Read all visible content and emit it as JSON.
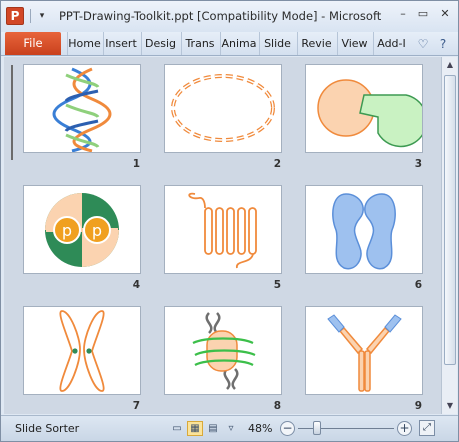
{
  "titlebar": {
    "app_icon_letter": "P",
    "title": "PPT-Drawing-Toolkit.ppt [Compatibility Mode] - Microsoft Po...",
    "quick_access_dropdown": "▾",
    "minimize": "–",
    "restore": "▭",
    "close": "✕"
  },
  "ribbon": {
    "file_label": "File",
    "tabs": [
      "Home",
      "Insert",
      "Design",
      "Transitions",
      "Animations",
      "Slide Show",
      "Review",
      "View",
      "Add-Ins"
    ],
    "tab_display": [
      "Home",
      "Insert",
      "Desig",
      "Trans",
      "Anima",
      "Slide",
      "Revie",
      "View",
      "Add-I"
    ],
    "icons": [
      "heart-icon",
      "help-icon"
    ]
  },
  "slides": [
    {
      "number": "1",
      "content": "dna-double-helix"
    },
    {
      "number": "2",
      "content": "dashed-ellipse"
    },
    {
      "number": "3",
      "content": "enzyme-substrate"
    },
    {
      "number": "4",
      "content": "phosphate-circle"
    },
    {
      "number": "5",
      "content": "membrane-protein"
    },
    {
      "number": "6",
      "content": "blue-kidney-shapes"
    },
    {
      "number": "7",
      "content": "chromosome"
    },
    {
      "number": "8",
      "content": "nucleosome"
    },
    {
      "number": "9",
      "content": "antibody"
    }
  ],
  "slide4_label": "p",
  "statusbar": {
    "view_label": "Slide Sorter",
    "zoom": "48%",
    "zoom_minus": "−",
    "zoom_plus": "+",
    "zoom_level": 0.2
  },
  "colors": {
    "orange": "#f08a3c",
    "peach": "#fbd3b0",
    "green": "#2e8b57",
    "light_green": "#c9f2c2",
    "blue": "#5b8fd9",
    "light_blue": "#9ec1ef",
    "gray": "#6f6f6f"
  }
}
